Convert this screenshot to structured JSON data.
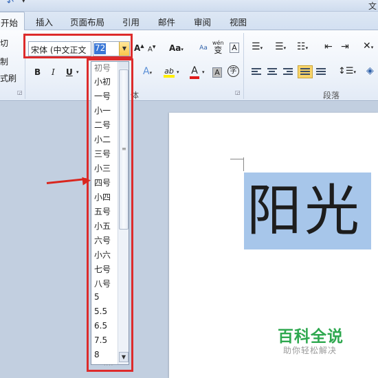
{
  "window": {
    "title_fragment": "文"
  },
  "tabs": [
    {
      "label": "开始",
      "active": true
    },
    {
      "label": "插入"
    },
    {
      "label": "页面布局"
    },
    {
      "label": "引用"
    },
    {
      "label": "邮件"
    },
    {
      "label": "审阅"
    },
    {
      "label": "视图"
    }
  ],
  "clipboard": {
    "cut": "剪切",
    "copy": "复制",
    "format_painter": "格式刷"
  },
  "font": {
    "name": "宋体 (中文正文",
    "size": "72",
    "group_label_tail": "体",
    "bold": "B",
    "italic": "I",
    "underline": "U",
    "change_case": "Aa",
    "phonetic_top": "wén",
    "phonetic_char": "变",
    "char_border": "A",
    "char_shading": "A",
    "enclose_char": "字",
    "highlight_label": "ab",
    "font_color_label": "A",
    "text_effects": "A"
  },
  "paragraph": {
    "group_label": "段落"
  },
  "document": {
    "selected_text": "阳光"
  },
  "size_list": [
    "初号",
    "小初",
    "一号",
    "小一",
    "二号",
    "小二",
    "三号",
    "小三",
    "四号",
    "小四",
    "五号",
    "小五",
    "六号",
    "小六",
    "七号",
    "八号",
    "5",
    "5.5",
    "6.5",
    "7.5",
    "8"
  ],
  "watermark": {
    "title": "百科全说",
    "subtitle": "助你轻松解决"
  },
  "colors": {
    "highlight_red": "#dd2b2b",
    "selection_blue": "#a7c6ea",
    "watermark_green": "#2ea84f"
  }
}
